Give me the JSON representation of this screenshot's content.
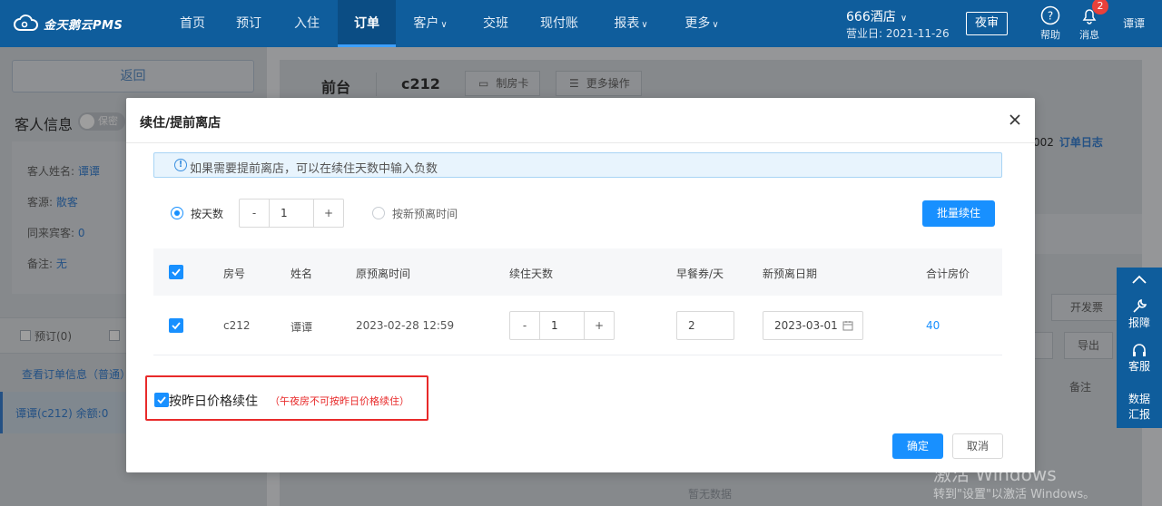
{
  "brand": {
    "name": "金天鹅云PMS"
  },
  "nav": {
    "items": [
      {
        "label": "首页"
      },
      {
        "label": "预订"
      },
      {
        "label": "入住"
      },
      {
        "label": "订单"
      },
      {
        "label": "客户"
      },
      {
        "label": "交班"
      },
      {
        "label": "现付账"
      },
      {
        "label": "报表"
      },
      {
        "label": "更多"
      }
    ],
    "active": "订单"
  },
  "header": {
    "hotel": "666酒店",
    "business_day": "营业日: 2021-11-26",
    "night_audit": "夜审",
    "help": "帮助",
    "messages": "消息",
    "message_count": "2",
    "user": "谭谭"
  },
  "left_panel": {
    "back": "返回",
    "guest_info_title": "客人信息",
    "secret_toggle": "保密",
    "guest_name_label": "客人姓名: ",
    "guest_name": "谭谭",
    "source_label": "客源: ",
    "source": "散客",
    "companions_label": "同来宾客: ",
    "companions": "0",
    "remark_label": "备注: ",
    "remark": "无",
    "tab_booking": "预订(0)",
    "view_order": "查看订单信息（普通）",
    "guest_item": "谭谭(c212)  余额:0"
  },
  "right_panel": {
    "front_desk": "前台",
    "room": "c212",
    "make_card": "制房卡",
    "more_actions": "更多操作",
    "order_id_tail": "002",
    "order_log": "订单日志",
    "invoice": "开发票",
    "export": "导出",
    "remark_col": "备注",
    "no_data": "暂无数据"
  },
  "floatbar": {
    "report": "报障",
    "service": "客服",
    "data_report_1": "数据",
    "data_report_2": "汇报"
  },
  "modal": {
    "title": "续住/提前离店",
    "tip": "如果需要提前离店，可以在续住天数中输入负数",
    "mode_by_days": "按天数",
    "days_value": "1",
    "minus": "-",
    "plus": "+",
    "mode_by_new_time": "按新预离时间",
    "batch_extend": "批量续住",
    "columns": [
      "房号",
      "姓名",
      "原预离时间",
      "续住天数",
      "早餐券/天",
      "新预离日期",
      "合计房价"
    ],
    "row": {
      "room": "c212",
      "name": "谭谭",
      "orig_departure": "2023-02-28 12:59",
      "extend_days": "1",
      "breakfast": "2",
      "new_departure": "2023-03-01",
      "total_price": "40"
    },
    "yesterday_price_label": "按昨日价格续住",
    "yesterday_price_note": "（午夜房不可按昨日价格续住）",
    "confirm": "确定",
    "cancel": "取消"
  },
  "watermark": {
    "line1": "激活 Windows",
    "line2": "转到\"设置\"以激活 Windows。"
  },
  "colors": {
    "nav_bg": "#0f5d9c",
    "primary": "#1890ff",
    "highlight_border": "#e82a2a"
  }
}
